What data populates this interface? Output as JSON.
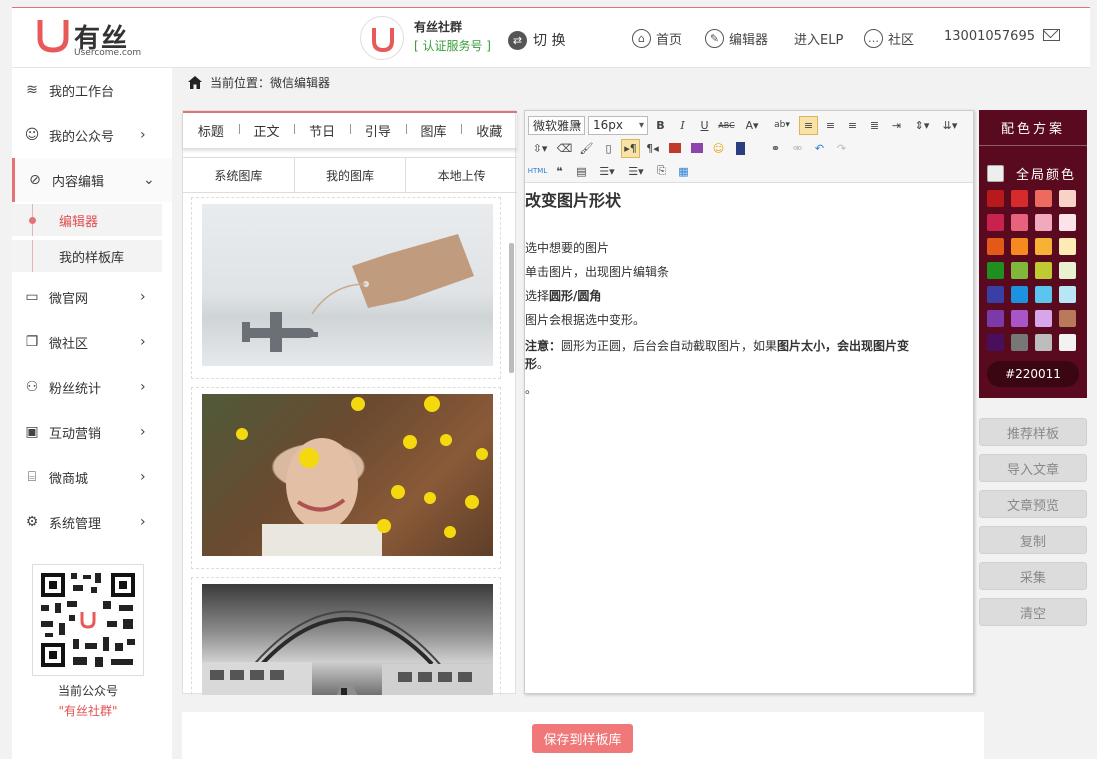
{
  "header": {
    "logo_cn": "有丝",
    "logo_en": "Usercome.com",
    "account_name": "有丝社群",
    "account_tag": "[ 认证服务号 ]",
    "switch_label": "切 换",
    "nav": [
      "首页",
      "编辑器",
      "进入ELP",
      "社区"
    ],
    "phone": "13001057695"
  },
  "sidebar": {
    "items": [
      {
        "label": "我的工作台",
        "icon": "layers-icon"
      },
      {
        "label": "我的公众号",
        "icon": "user-icon"
      },
      {
        "label": "内容编辑",
        "icon": "compass-icon"
      },
      {
        "label": "微官网",
        "icon": "monitor-icon"
      },
      {
        "label": "微社区",
        "icon": "copy-icon"
      },
      {
        "label": "粉丝统计",
        "icon": "people-icon"
      },
      {
        "label": "互动营销",
        "icon": "briefcase-icon"
      },
      {
        "label": "微商城",
        "icon": "store-icon"
      },
      {
        "label": "系统管理",
        "icon": "gear-icon"
      }
    ],
    "subitems": [
      "编辑器",
      "我的样板库"
    ],
    "qr_caption": "当前公众号",
    "qr_account": "\"有丝社群\""
  },
  "breadcrumb": "当前位置：微信编辑器",
  "library": {
    "tabs": [
      "标题",
      "正文",
      "节日",
      "引导",
      "图库",
      "收藏"
    ],
    "subtabs": [
      "系统图库",
      "我的图库",
      "本地上传"
    ]
  },
  "editor": {
    "font_family": "微软雅黑",
    "font_size": "16px",
    "heading": "改变图片形状",
    "lines": [
      {
        "parts": [
          {
            "t": "选中想要的图片",
            "b": false
          }
        ]
      },
      {
        "parts": [
          {
            "t": "单击图片，出现图片编辑条",
            "b": false
          }
        ]
      },
      {
        "parts": [
          {
            "t": "选择",
            "b": false
          },
          {
            "t": "圆形/圆角",
            "b": true
          }
        ]
      },
      {
        "parts": [
          {
            "t": "图片会根据选中变形。",
            "b": false
          }
        ]
      },
      {
        "parts": [
          {
            "t": "注意：",
            "b": true
          },
          {
            "t": "圆形为正圆，后台会自动截取图片，如果",
            "b": false
          },
          {
            "t": "图片太小，会出现图片变",
            "b": true
          }
        ]
      },
      {
        "parts": [
          {
            "t": "形",
            "b": true
          },
          {
            "t": "。",
            "b": false
          }
        ]
      },
      {
        "parts": [
          {
            "t": "。",
            "b": false
          }
        ]
      }
    ]
  },
  "color_panel": {
    "title": "配色方案",
    "global_label": "全局颜色",
    "selected_hex": "#220011",
    "swatches": [
      "#b8191a",
      "#d72b2b",
      "#ec6a5e",
      "#f6d3c6",
      "#c8234f",
      "#e8617d",
      "#f2a9bd",
      "#fbe3ea",
      "#e35a18",
      "#f6891f",
      "#f7b234",
      "#fdebb5",
      "#1f8f1f",
      "#7fb83a",
      "#c0cb34",
      "#e9f1d0",
      "#3a3fa5",
      "#1d93e0",
      "#5bc4ef",
      "#b9e6f7",
      "#7c3aa8",
      "#a855c7",
      "#d7a6e8",
      "#b87a5a",
      "#4a0f5c",
      "#777777",
      "#bdbdbd",
      "#f2f2f2"
    ]
  },
  "actions": [
    "推荐样板",
    "导入文章",
    "文章预览",
    "复制",
    "采集",
    "清空"
  ],
  "save_button": "保存到样板库"
}
